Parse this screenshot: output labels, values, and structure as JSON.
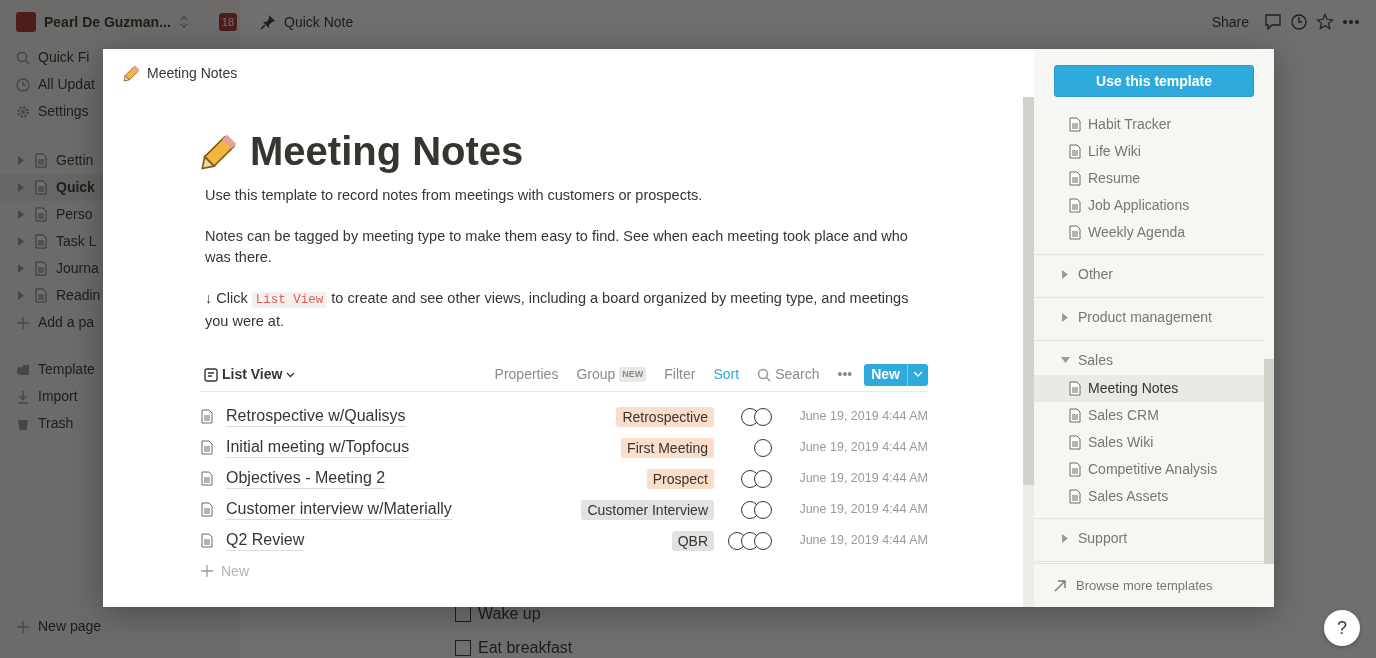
{
  "sidebar": {
    "workspace": "Pearl De Guzman...",
    "badge": "18",
    "nav": [
      "Quick Fi",
      "All Updat",
      "Settings"
    ],
    "pages": [
      {
        "label": "Gettin",
        "selected": false
      },
      {
        "label": "Quick",
        "selected": true
      },
      {
        "label": "Perso",
        "selected": false
      },
      {
        "label": "Task L",
        "selected": false
      },
      {
        "label": "Journa",
        "selected": false
      },
      {
        "label": "Readin",
        "selected": false
      }
    ],
    "add_page": "Add a pa",
    "tools": [
      "Template",
      "Import",
      "Trash"
    ],
    "new_page": "New page"
  },
  "topbar": {
    "breadcrumb": "Quick Note",
    "share": "Share"
  },
  "background_todos": [
    {
      "label": "Wake up",
      "checked": false
    },
    {
      "label": "Eat breakfast",
      "checked": false
    }
  ],
  "help": "?",
  "modal": {
    "header_title": "Meeting Notes",
    "title": "Meeting Notes",
    "paragraphs": [
      {
        "text": "Use this template to record notes from meetings with customers or prospects."
      },
      {
        "text": "Notes can be tagged by meeting type to make them easy to find. See when each meeting took place and who was there."
      },
      {
        "text": "↓ Click",
        "code": "List View",
        "after": "to create and see other views, including a board organized by meeting type, and meetings you were at."
      }
    ],
    "view": {
      "name": "List View",
      "actions": [
        {
          "label": "Properties",
          "active": false
        },
        {
          "label": "Group",
          "active": false,
          "badge": "NEW"
        },
        {
          "label": "Filter",
          "active": false
        },
        {
          "label": "Sort",
          "active": true
        }
      ],
      "search": "Search",
      "more": "•••",
      "new_button": "New"
    },
    "rows": [
      {
        "title": "Retrospective w/Qualisys",
        "tag": "Retrospective",
        "color": "#fadec9",
        "date": "June 19, 2019 4:44 AM"
      },
      {
        "title": "Initial meeting w/Topfocus",
        "tag": "First Meeting",
        "color": "#fadec9",
        "date": "June 19, 2019 4:44 AM"
      },
      {
        "title": "Objectives - Meeting 2",
        "tag": "Prospect",
        "color": "#fadec9",
        "date": "June 19, 2019 4:44 AM"
      },
      {
        "title": "Customer interview w/Materially",
        "tag": "Customer Interview",
        "color": "#e3e2e0",
        "date": "June 19, 2019 4:44 AM"
      },
      {
        "title": "Q2 Review",
        "tag": "QBR",
        "color": "#e3e2e0",
        "date": "June 19, 2019 4:44 AM"
      }
    ],
    "new_row": "New"
  },
  "templates": {
    "button": "Use this template",
    "groups": [
      {
        "items": [
          {
            "label": "Habit Tracker",
            "selected": false
          },
          {
            "label": "Life Wiki",
            "selected": false
          },
          {
            "label": "Resume",
            "selected": false
          },
          {
            "label": "Job Applications",
            "selected": false
          },
          {
            "label": "Weekly Agenda",
            "selected": false
          }
        ]
      },
      {
        "name": "Other",
        "expanded": false
      },
      {
        "name": "Product management",
        "expanded": false
      },
      {
        "name": "Sales",
        "expanded": true,
        "items": [
          {
            "label": "Meeting Notes",
            "selected": true
          },
          {
            "label": "Sales CRM",
            "selected": false
          },
          {
            "label": "Sales Wiki",
            "selected": false
          },
          {
            "label": "Competitive Analysis",
            "selected": false
          },
          {
            "label": "Sales Assets",
            "selected": false
          }
        ]
      },
      {
        "name": "Support",
        "expanded": false
      }
    ],
    "browse": "Browse more templates"
  }
}
